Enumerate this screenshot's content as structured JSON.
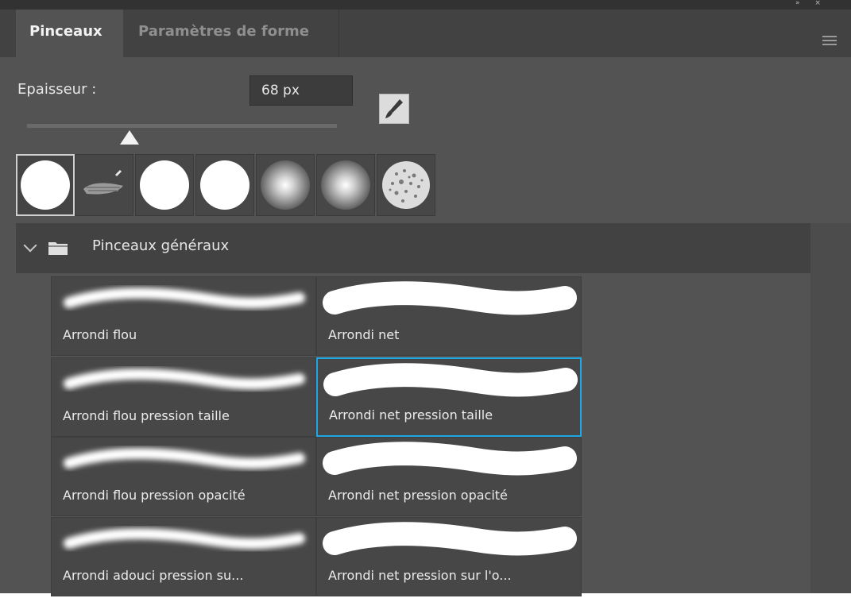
{
  "tabs": [
    {
      "label": "Pinceaux",
      "active": true
    },
    {
      "label": "Paramètres de forme",
      "active": false
    }
  ],
  "size": {
    "label": "Epaisseur :",
    "value": "68 px",
    "slider_fraction": 0.33
  },
  "icons": {
    "menu": "panel-menu-icon",
    "brush": "paintbrush-icon",
    "folder": "folder-icon",
    "chevron": "chevron-down-icon"
  },
  "colors": {
    "accent": "#1ea7e4",
    "panel": "#535353",
    "header": "#424242"
  },
  "presets": [
    "hard-round",
    "textured-chalk",
    "hard-round",
    "hard-round",
    "soft-round",
    "soft-round",
    "spatter"
  ],
  "group": {
    "label": "Pinceaux généraux"
  },
  "brushes": [
    {
      "label": "Arrondi flou",
      "stroke": "soft"
    },
    {
      "label": "Arrondi net",
      "stroke": "hard"
    },
    {
      "label": "Arrondi flou pression taille",
      "stroke": "soft"
    },
    {
      "label": "Arrondi net pression taille",
      "stroke": "hard",
      "selected": true
    },
    {
      "label": "Arrondi flou pression opacité",
      "stroke": "soft"
    },
    {
      "label": "Arrondi net pression opacité",
      "stroke": "hard"
    },
    {
      "label": "Arrondi adouci pression su...",
      "stroke": "soft"
    },
    {
      "label": "Arrondi net pression sur l'o...",
      "stroke": "hard"
    }
  ]
}
